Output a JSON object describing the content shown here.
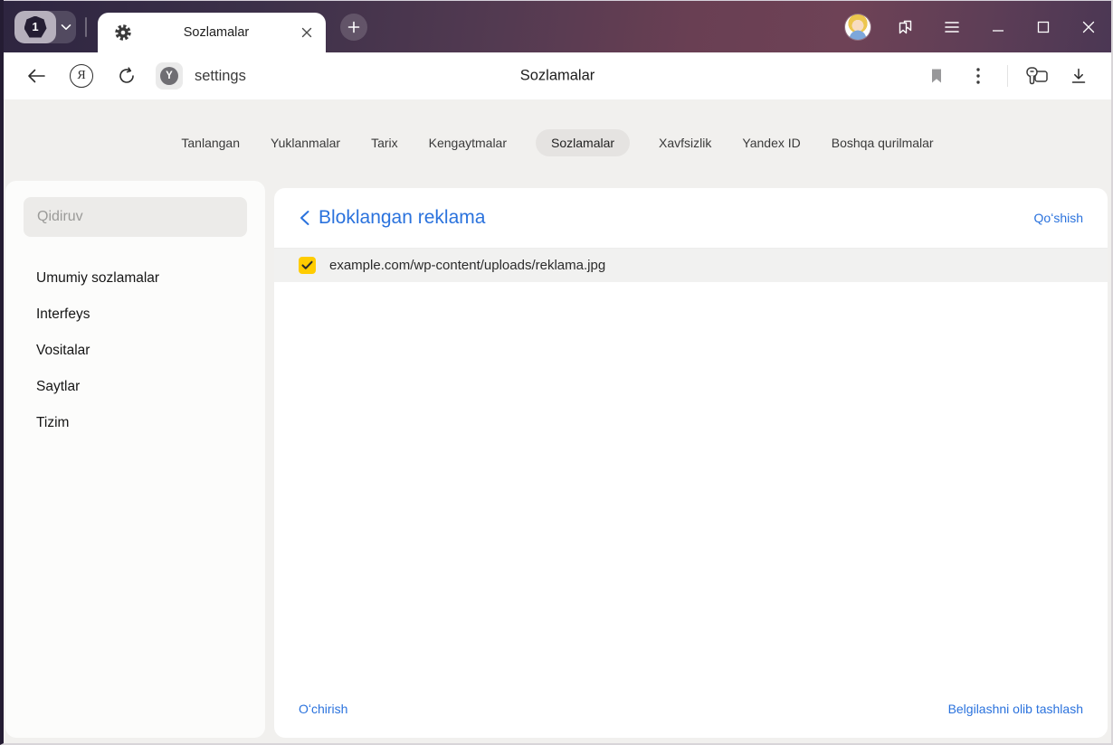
{
  "titlebar": {
    "tab_counter": "1",
    "tab_title": "Sozlamalar"
  },
  "toolbar": {
    "url": "settings",
    "page_title": "Sozlamalar",
    "search_engine_badge": "Y",
    "yandex_logo_letter": "Я"
  },
  "nav": {
    "items": [
      "Tanlangan",
      "Yuklanmalar",
      "Tarix",
      "Kengaytmalar",
      "Sozlamalar",
      "Xavfsizlik",
      "Yandex ID",
      "Boshqa qurilmalar"
    ],
    "selected": "Sozlamalar"
  },
  "sidebar": {
    "search_placeholder": "Qidiruv",
    "items": [
      "Umumiy sozlamalar",
      "Interfeys",
      "Vositalar",
      "Saytlar",
      "Tizim"
    ]
  },
  "content": {
    "title": "Bloklangan reklama",
    "add_link": "Qoʻshish",
    "rows": [
      {
        "url": "example.com/wp-content/uploads/reklama.jpg",
        "checked": true
      }
    ],
    "footer": {
      "delete_link": "Oʻchirish",
      "clear_selection_link": "Belgilashni olib tashlash"
    }
  },
  "colors": {
    "accent_blue": "#2a72dd",
    "checkbox_yellow": "#ffcc00",
    "titlebar_dark_purple": "#2e2540",
    "titlebar_maroon": "#6e4256",
    "selected_pill_gray": "#e5e3e1",
    "row_gray": "#f1f1f0"
  }
}
